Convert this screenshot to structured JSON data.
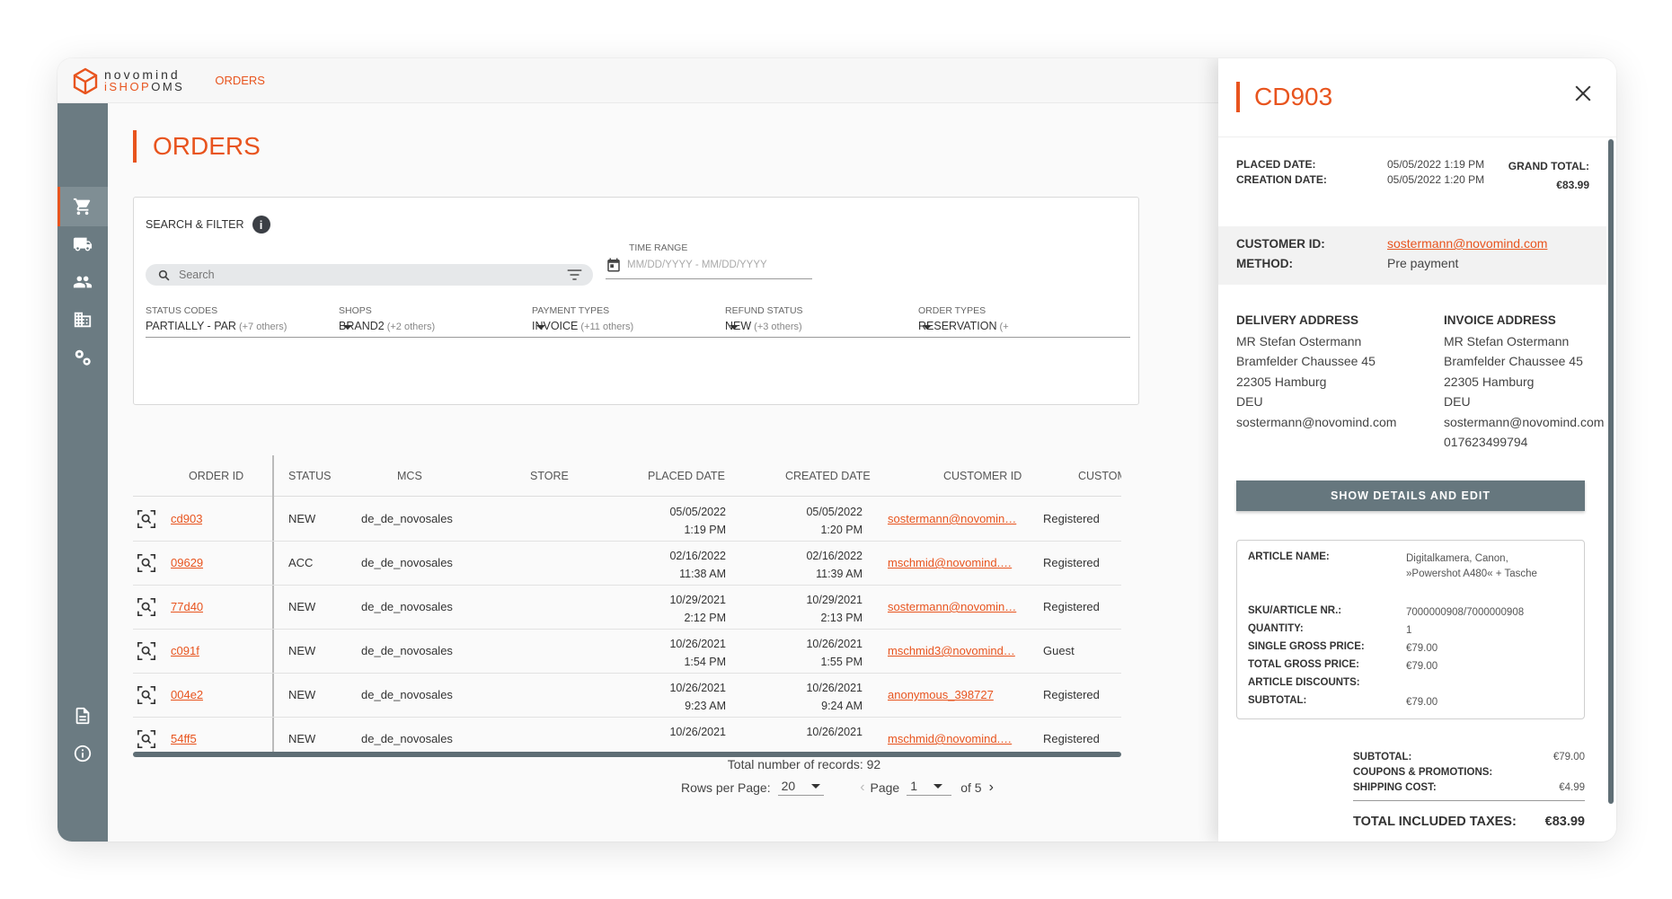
{
  "app": {
    "logo_line1": "novomind",
    "logo_line2a": "iSHOP",
    "logo_line2b": "OMS",
    "nav_orders": "ORDERS"
  },
  "page": {
    "title": "ORDERS"
  },
  "filter": {
    "heading": "SEARCH & FILTER",
    "info": "i",
    "search_placeholder": "Search",
    "time_range_label": "TIME RANGE",
    "time_range_placeholder": "MM/DD/YYYY - MM/DD/YYYY",
    "dropdowns": [
      {
        "label": "STATUS CODES",
        "value": "PARTIALLY - PAR",
        "more": "(+7 others)"
      },
      {
        "label": "SHOPS",
        "value": "BRAND2",
        "more": "(+2 others)"
      },
      {
        "label": "PAYMENT TYPES",
        "value": "INVOICE",
        "more": "(+11 others)"
      },
      {
        "label": "REFUND STATUS",
        "value": "NEW",
        "more": "(+3 others)"
      },
      {
        "label": "ORDER TYPES",
        "value": "RESERVATION",
        "more": "(+"
      }
    ]
  },
  "table": {
    "headers": {
      "order_id": "ORDER ID",
      "status": "STATUS",
      "mcs": "MCS",
      "store": "STORE",
      "placed": "PLACED DATE",
      "created": "CREATED DATE",
      "customer": "CUSTOMER ID",
      "customer_reg": "CUSTOMER RE"
    },
    "rows": [
      {
        "id": "cd903",
        "status": "NEW",
        "mcs": "de_de_novosales",
        "placed_date": "05/05/2022",
        "placed_time": "1:19 PM",
        "created_date": "05/05/2022",
        "created_time": "1:20 PM",
        "customer": "sostermann@novomin…",
        "type": "Registered"
      },
      {
        "id": "09629",
        "status": "ACC",
        "mcs": "de_de_novosales",
        "placed_date": "02/16/2022",
        "placed_time": "11:38 AM",
        "created_date": "02/16/2022",
        "created_time": "11:39 AM",
        "customer": "mschmid@novomind.…",
        "type": "Registered"
      },
      {
        "id": "77d40",
        "status": "NEW",
        "mcs": "de_de_novosales",
        "placed_date": "10/29/2021",
        "placed_time": "2:12 PM",
        "created_date": "10/29/2021",
        "created_time": "2:13 PM",
        "customer": "sostermann@novomin…",
        "type": "Registered"
      },
      {
        "id": "c091f",
        "status": "NEW",
        "mcs": "de_de_novosales",
        "placed_date": "10/26/2021",
        "placed_time": "1:54 PM",
        "created_date": "10/26/2021",
        "created_time": "1:55 PM",
        "customer": "mschmid3@novomind…",
        "type": "Guest"
      },
      {
        "id": "004e2",
        "status": "NEW",
        "mcs": "de_de_novosales",
        "placed_date": "10/26/2021",
        "placed_time": "9:23 AM",
        "created_date": "10/26/2021",
        "created_time": "9:24 AM",
        "customer": "anonymous_398727",
        "type": "Registered"
      },
      {
        "id": "54ff5",
        "status": "NEW",
        "mcs": "de_de_novosales",
        "placed_date": "10/26/2021",
        "placed_time": "",
        "created_date": "10/26/2021",
        "created_time": "",
        "customer": "mschmid@novomind.…",
        "type": "Registered"
      }
    ],
    "total": "Total number of records: 92",
    "rows_per_page_label": "Rows per Page:",
    "rows_per_page": "20",
    "page_label": "Page",
    "page": "1",
    "of_pages": "of 5"
  },
  "panel": {
    "title": "CD903",
    "placed_label": "PLACED DATE:",
    "placed_value": "05/05/2022 1:19 PM",
    "creation_label": "CREATION DATE:",
    "creation_value": "05/05/2022 1:20 PM",
    "grand_total_label": "GRAND TOTAL:",
    "grand_total_value": "€83.99",
    "customer_label": "CUSTOMER ID:",
    "customer_value": "sostermann@novomind.com",
    "method_label": "METHOD:",
    "method_value": "Pre payment",
    "delivery_heading": "DELIVERY ADDRESS",
    "delivery_lines": [
      "MR Stefan Ostermann",
      "Bramfelder Chaussee 45",
      "22305 Hamburg",
      "DEU",
      "sostermann@novomind.com"
    ],
    "invoice_heading": "INVOICE ADDRESS",
    "invoice_lines": [
      "MR Stefan Ostermann",
      "Bramfelder Chaussee 45",
      "22305 Hamburg",
      "DEU",
      "sostermann@novomind.com",
      "017623499794"
    ],
    "edit_button": "SHOW DETAILS AND EDIT",
    "article": {
      "name_label": "ARTICLE NAME:",
      "name_value": "Digitalkamera, Canon, »Powershot A480« + Tasche",
      "sku_label": "SKU/ARTICLE NR.:",
      "sku_value": "7000000908/7000000908",
      "qty_label": "QUANTITY:",
      "qty_value": "1",
      "single_label": "SINGLE GROSS PRICE:",
      "single_value": "€79.00",
      "total_label": "TOTAL GROSS PRICE:",
      "total_value": "€79.00",
      "disc_label": "ARTICLE DISCOUNTS:",
      "disc_value": "",
      "sub_label": "SUBTOTAL:",
      "sub_value": "€79.00"
    },
    "summary": {
      "sub_label": "SUBTOTAL:",
      "sub_value": "€79.00",
      "coupons_label": "COUPONS & PROMOTIONS:",
      "coupons_value": "",
      "ship_label": "SHIPPING COST:",
      "ship_value": "€4.99",
      "tax_label": "TOTAL INCLUDED TAXES:",
      "tax_value": "€83.99"
    }
  }
}
